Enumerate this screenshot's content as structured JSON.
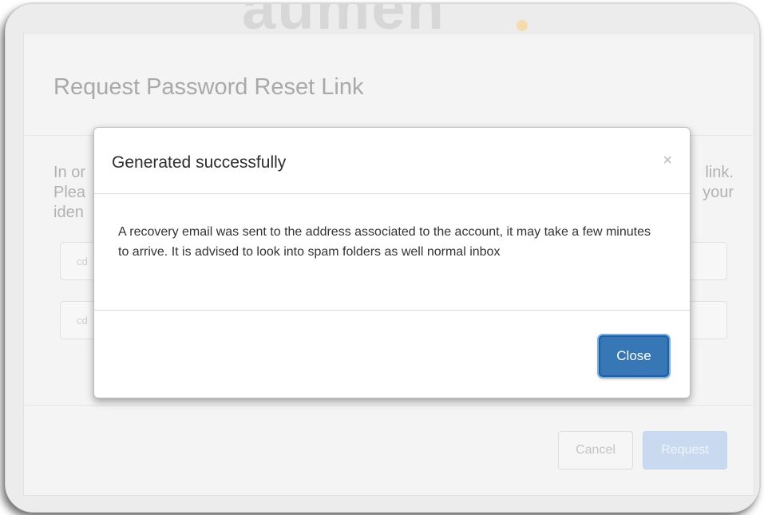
{
  "background_page": {
    "title": "Request Password Reset Link",
    "text_left_lines": [
      "In or",
      "Plea",
      "iden"
    ],
    "text_right_lines": [
      "link.",
      "your"
    ],
    "input1_placeholder": "cd",
    "input2_placeholder": "cd",
    "cancel_label": "Cancel",
    "request_label": "Request"
  },
  "modal": {
    "title": "Generated successfully",
    "close_x": "×",
    "body": "A recovery email was sent to the address associated to the account, it may take a few minutes to arrive. It is advised to look into spam folders as well normal inbox",
    "close_button_label": "Close"
  },
  "colors": {
    "primary": "#3777b6",
    "request_disabled": "#c9daf0"
  }
}
